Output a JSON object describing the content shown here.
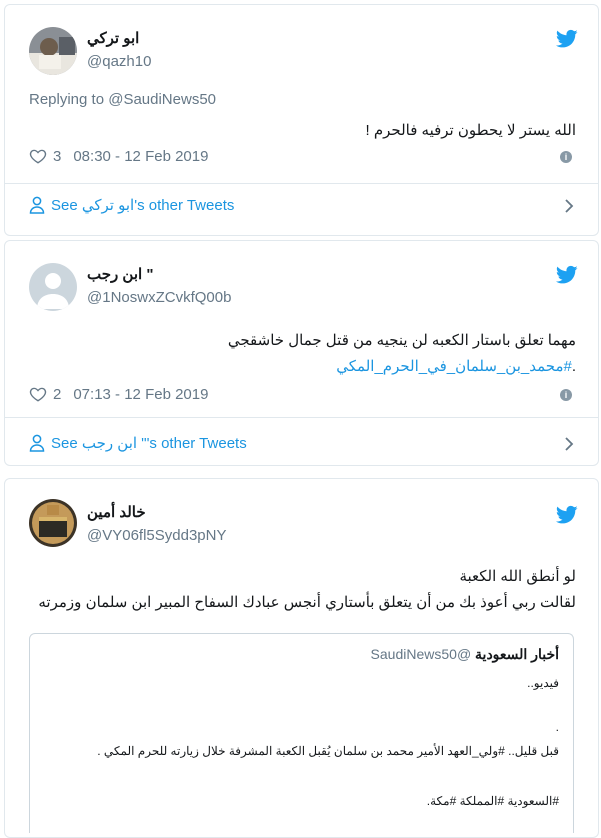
{
  "tweets": [
    {
      "name": "ابو تركي",
      "handle": "@qazh10",
      "replying_prefix": "Replying to ",
      "replying_to": "@SaudiNews50",
      "text": "الله يستر لا يحطون ترفيه فالحرم !",
      "likes": "3",
      "timestamp": "08:30 - 12 Feb 2019",
      "see_prefix": "See ",
      "see_name": "ابو تركي",
      "see_suffix": "'s other Tweets"
    },
    {
      "name": "ابن رجب \"",
      "handle": "@1NoswxZCvkfQ00b",
      "text_line1": "مهما تعلق باستار الكعبه لن ينجيه من قتل جمال خاشقجي",
      "hashtag": "#محمد_بن_سلمان_في_الحرم_المكي",
      "hashtag_trail": ".",
      "likes": "2",
      "timestamp": "07:13 - 12 Feb 2019",
      "see_prefix": "See ",
      "see_name": "ابن رجب \"",
      "see_suffix": "'s other Tweets"
    },
    {
      "name": "خالد أمين",
      "handle": "@VY06fl5Sydd3pNY",
      "text_line1": "لو أنطق الله الكعبة",
      "text_line2": "لقالت ربي أعوذ بك من أن يتعلق بأستاري  أنجس عبادك السفاح المبير ابن سلمان وزمرته",
      "quote": {
        "name": "أخبار السعودية",
        "handle": "@SaudiNews50",
        "line1": "فيديو..",
        "line2": ".",
        "line3": "قبل قليل.. #ولي_العهد الأمير محمد بن سلمان يُقبل الكعبة المشرفة خلال زيارته للحرم المكي .",
        "line4": "#السعودية #المملكة #مكة."
      }
    }
  ],
  "colors": {
    "twitter_blue": "#1da1f2",
    "link_blue": "#1b95e0",
    "muted": "#657786",
    "border": "#e1e8ed"
  },
  "icons": {
    "brand": "twitter-bird-icon",
    "like": "heart-icon",
    "info": "info-icon",
    "profile": "person-icon",
    "chevron": "chevron-right-icon"
  }
}
